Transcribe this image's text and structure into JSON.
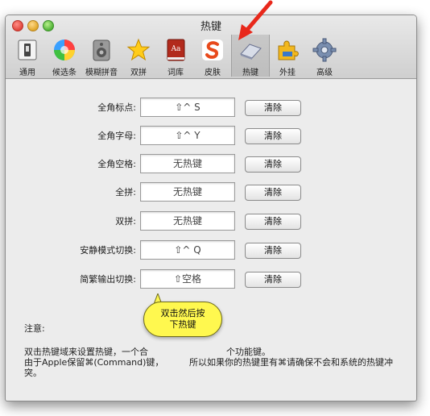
{
  "window": {
    "title": "热键"
  },
  "toolbar": {
    "items": [
      {
        "label": "通用",
        "icon": "switch-icon"
      },
      {
        "label": "候选条",
        "icon": "color-wheel-icon"
      },
      {
        "label": "模糊拼音",
        "icon": "speaker-icon"
      },
      {
        "label": "双拼",
        "icon": "star-icon"
      },
      {
        "label": "词库",
        "icon": "dictionary-icon"
      },
      {
        "label": "皮肤",
        "icon": "sogou-logo-icon"
      },
      {
        "label": "热键",
        "icon": "keyboard-key-icon"
      },
      {
        "label": "外挂",
        "icon": "puzzle-icon"
      },
      {
        "label": "高级",
        "icon": "gear-icon"
      }
    ],
    "selected": "热键"
  },
  "hotkeys": [
    {
      "label": "全角标点:",
      "value": "⇧^ S"
    },
    {
      "label": "全角字母:",
      "value": "⇧^ Y"
    },
    {
      "label": "全角空格:",
      "value": "无热键"
    },
    {
      "label": "全拼:",
      "value": "无热键"
    },
    {
      "label": "双拼:",
      "value": "无热键"
    },
    {
      "label": "安静模式切换:",
      "value": "⇧^ Q"
    },
    {
      "label": "简繁输出切换:",
      "value": "⇧空格"
    }
  ],
  "clear_label": "清除",
  "notes": {
    "title": "注意:",
    "line1": "双击热键域来设置热键，一个合",
    "line1b": "个功能键。",
    "line2a": "由于Apple保留⌘(Command)键，",
    "line2b": "所以如果你的热键里有⌘请确保不会和系统的热键冲",
    "line3": "突。"
  },
  "callout": {
    "line1": "双击然后按",
    "line2": "下热键"
  },
  "colors": {
    "callout_fill": "#fff84f",
    "arrow": "#e8281b"
  }
}
